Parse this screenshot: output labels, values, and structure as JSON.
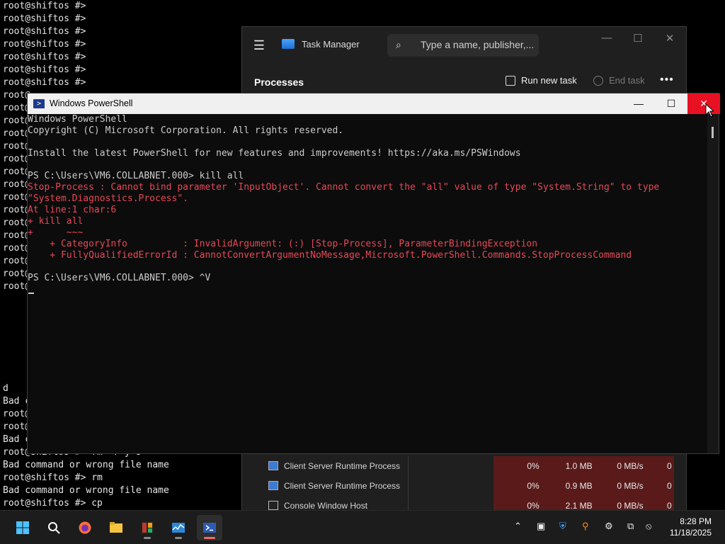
{
  "background_terminal": {
    "lines_top": [
      "root@shiftos #>",
      "root@shiftos #>",
      "root@shiftos #>",
      "root@shiftos #>",
      "root@shiftos #>",
      "root@shiftos #>",
      "root@shiftos #>",
      "root@",
      "root@",
      "root@",
      "root@",
      "root@",
      "root@",
      "root@",
      "root@",
      "root@",
      "root@",
      "root@",
      "root@",
      "root@",
      "root@",
      "root@",
      "root@"
    ],
    "lines_bottom": [
      "d",
      "Bad c",
      "root@",
      "root@",
      "Bad c",
      "root@shiftos #> rm -r y s",
      "Bad command or wrong file name",
      "root@shiftos #> rm",
      "Bad command or wrong file name",
      "root@shiftos #> cp"
    ]
  },
  "task_manager": {
    "title": "Task Manager",
    "search_placeholder": "Type a name, publisher,...",
    "section_title": "Processes",
    "run_new_task": "Run new task",
    "end_task": "End task",
    "more": "•••",
    "rows": [
      {
        "name": "Client Server Runtime Process",
        "cpu": "0%",
        "memory": "1.0 MB",
        "disk": "0 MB/s",
        "network": "0",
        "icon": "window"
      },
      {
        "name": "Client Server Runtime Process",
        "cpu": "0%",
        "memory": "0.9 MB",
        "disk": "0 MB/s",
        "network": "0",
        "icon": "window"
      },
      {
        "name": "Console Window Host",
        "cpu": "0%",
        "memory": "2.1 MB",
        "disk": "0 MB/s",
        "network": "0",
        "icon": "console"
      }
    ]
  },
  "powershell": {
    "title": "Windows PowerShell",
    "lines": [
      {
        "text": "Windows PowerShell",
        "type": "out"
      },
      {
        "text": "Copyright (C) Microsoft Corporation. All rights reserved.",
        "type": "out"
      },
      {
        "text": "",
        "type": "out"
      },
      {
        "text": "Install the latest PowerShell for new features and improvements! https://aka.ms/PSWindows",
        "type": "out"
      },
      {
        "text": "",
        "type": "out"
      },
      {
        "text": "PS C:\\Users\\VM6.COLLABNET.000> kill all",
        "type": "out"
      },
      {
        "text": "Stop-Process : Cannot bind parameter 'InputObject'. Cannot convert the \"all\" value of type \"System.String\" to type",
        "type": "err"
      },
      {
        "text": "\"System.Diagnostics.Process\".",
        "type": "err"
      },
      {
        "text": "At line:1 char:6",
        "type": "err"
      },
      {
        "text": "+ kill all",
        "type": "err"
      },
      {
        "text": "+      ~~~",
        "type": "err"
      },
      {
        "text": "    + CategoryInfo          : InvalidArgument: (:) [Stop-Process], ParameterBindingException",
        "type": "err"
      },
      {
        "text": "    + FullyQualifiedErrorId : CannotConvertArgumentNoMessage,Microsoft.PowerShell.Commands.StopProcessCommand",
        "type": "err"
      },
      {
        "text": "",
        "type": "out"
      },
      {
        "text": "PS C:\\Users\\VM6.COLLABNET.000> ^V",
        "type": "out"
      }
    ]
  },
  "taskbar": {
    "apps": [
      "start-icon",
      "search-icon",
      "firefox-icon",
      "file-explorer-icon",
      "app-icon",
      "task-manager-icon",
      "powershell-icon"
    ],
    "time": "8:28 PM",
    "date": "11/18/2025"
  },
  "colors": {
    "error_text": "#e74856",
    "close_button": "#e81123",
    "terminal_bg": "#0c0c0c"
  }
}
